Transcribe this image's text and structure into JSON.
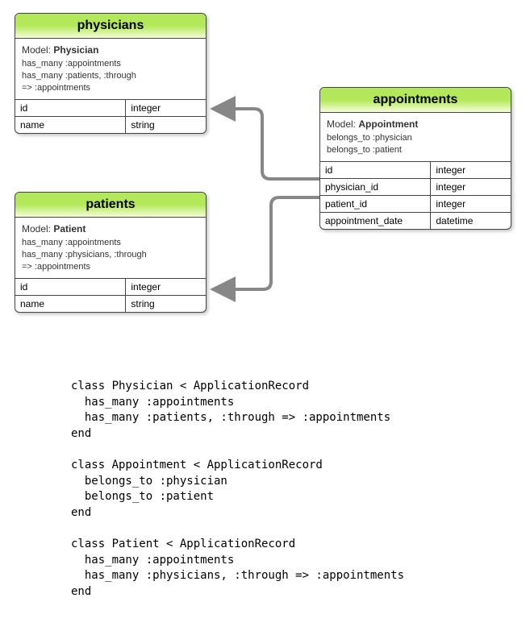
{
  "entities": {
    "physicians": {
      "title": "physicians",
      "model_label": "Model:",
      "model_name": "Physician",
      "assoc": [
        "has_many :appointments",
        "has_many :patients, :through",
        "=> :appointments"
      ],
      "attrs": [
        {
          "name": "id",
          "type": "integer"
        },
        {
          "name": "name",
          "type": "string"
        }
      ]
    },
    "patients": {
      "title": "patients",
      "model_label": "Model:",
      "model_name": "Patient",
      "assoc": [
        "has_many :appointments",
        "has_many :physicians, :through",
        "=> :appointments"
      ],
      "attrs": [
        {
          "name": "id",
          "type": "integer"
        },
        {
          "name": "name",
          "type": "string"
        }
      ]
    },
    "appointments": {
      "title": "appointments",
      "model_label": "Model:",
      "model_name": "Appointment",
      "assoc": [
        "belongs_to :physician",
        "belongs_to :patient"
      ],
      "attrs": [
        {
          "name": "id",
          "type": "integer"
        },
        {
          "name": "physician_id",
          "type": "integer"
        },
        {
          "name": "patient_id",
          "type": "integer"
        },
        {
          "name": "appointment_date",
          "type": "datetime"
        }
      ]
    }
  },
  "code": "class Physician < ApplicationRecord\n  has_many :appointments\n  has_many :patients, :through => :appointments\nend\n\nclass Appointment < ApplicationRecord\n  belongs_to :physician\n  belongs_to :patient\nend\n\nclass Patient < ApplicationRecord\n  has_many :appointments\n  has_many :physicians, :through => :appointments\nend"
}
